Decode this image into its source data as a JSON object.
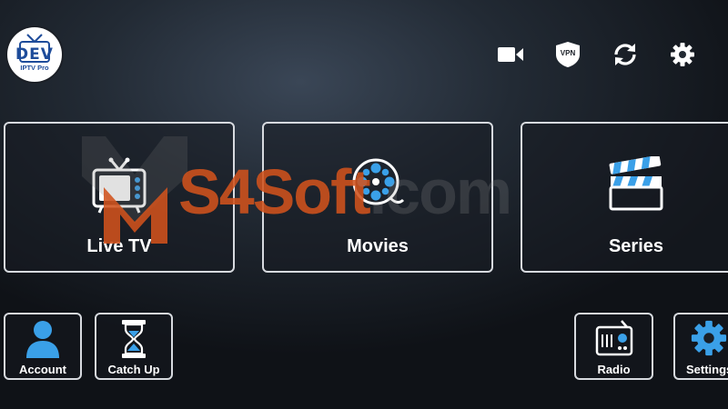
{
  "app": {
    "logo": {
      "brand": "DEV",
      "subtitle": "IPTV Pro"
    }
  },
  "toolbar": {
    "icons": [
      "video-camera-icon",
      "vpn-icon",
      "refresh-icon",
      "gear-icon"
    ],
    "vpn_label": "VPN"
  },
  "categories": [
    {
      "label": "Live TV",
      "icon": "tv-icon"
    },
    {
      "label": "Movies",
      "icon": "film-reel-icon"
    },
    {
      "label": "Series",
      "icon": "clapperboard-icon"
    }
  ],
  "tiles": [
    {
      "label": "Account",
      "icon": "user-icon"
    },
    {
      "label": "Catch Up",
      "icon": "hourglass-icon"
    },
    {
      "label": "Radio",
      "icon": "radio-icon"
    },
    {
      "label": "Settings",
      "icon": "gear-icon"
    }
  ],
  "watermark": {
    "main": "S4Soft",
    "suffix": ".com"
  },
  "colors": {
    "accent": "#3aa0e8",
    "watermark": "#d0521c",
    "logo_blue": "#1e4c9a",
    "card_border": "#d7dadf"
  }
}
